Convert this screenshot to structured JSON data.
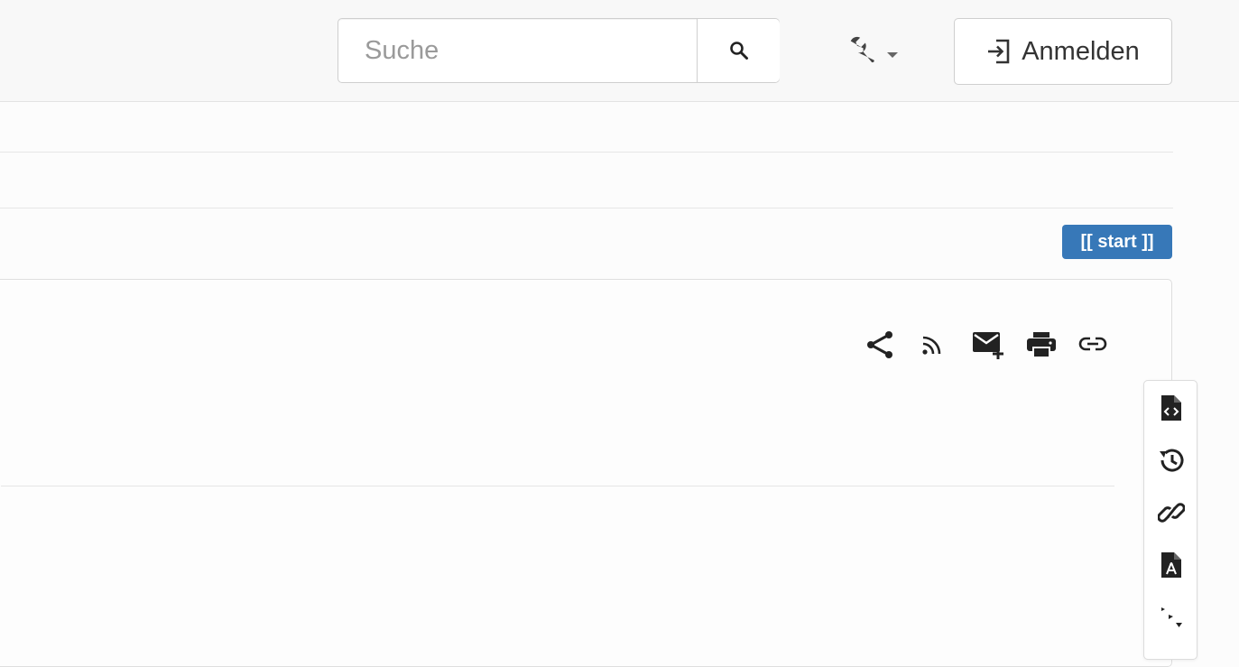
{
  "navbar": {
    "search": {
      "placeholder": "Suche",
      "value": "",
      "button_icon": "magnifier-icon"
    },
    "tools_menu": {
      "icon": "wrench-icon",
      "caret_icon": "caret-down-icon"
    },
    "login": {
      "label": "Anmelden",
      "icon": "sign-in-icon"
    }
  },
  "page": {
    "page_id_badge": "[[ start ]]",
    "page_tools": [
      {
        "name": "share-icon"
      },
      {
        "name": "rss-feed-icon"
      },
      {
        "name": "email-plus-icon"
      },
      {
        "name": "printer-icon"
      },
      {
        "name": "permalink-icon"
      }
    ],
    "side_toolbar": [
      {
        "name": "show-source-icon"
      },
      {
        "name": "revisions-history-icon"
      },
      {
        "name": "backlinks-icon"
      },
      {
        "name": "export-pdf-icon"
      },
      {
        "name": "back-to-top-icon"
      }
    ]
  },
  "colors": {
    "badge_background": "#3778b8",
    "navbar_background": "#f8f8f8",
    "icon_color": "#222222"
  }
}
